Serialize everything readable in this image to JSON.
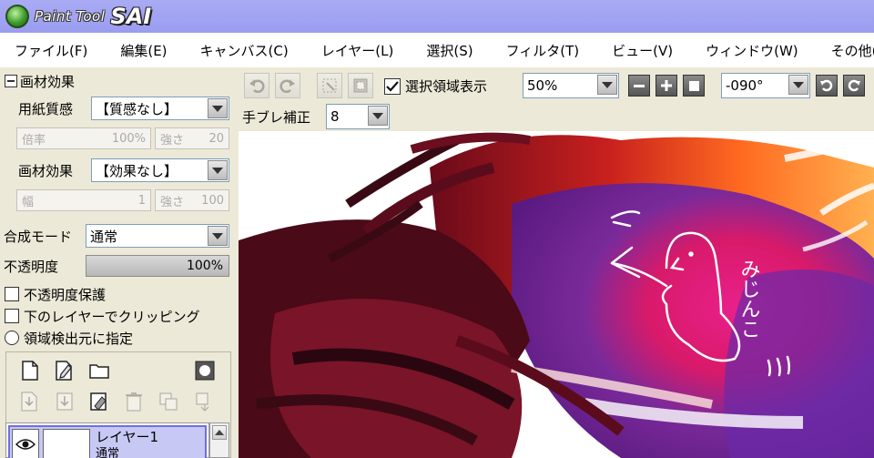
{
  "app": {
    "logo_small": "Paint Tool",
    "logo_big": "SAI"
  },
  "menu": [
    "ファイル(F)",
    "編集(E)",
    "キャンバス(C)",
    "レイヤー(L)",
    "選択(S)",
    "フィルタ(T)",
    "ビュー(V)",
    "ウィンドウ(W)",
    "その他(O)"
  ],
  "panel": {
    "section_title": "画材効果",
    "paper_label": "用紙質感",
    "paper_value": "【質感なし】",
    "paper_scale_label": "倍率",
    "paper_scale_value": "100%",
    "paper_strength_label": "強さ",
    "paper_strength_value": "20",
    "effect_label": "画材効果",
    "effect_value": "【効果なし】",
    "effect_width_label": "幅",
    "effect_width_value": "1",
    "effect_strength_label": "強さ",
    "effect_strength_value": "100",
    "blend_label": "合成モード",
    "blend_value": "通常",
    "opacity_label": "不透明度",
    "opacity_value": "100%",
    "opacity_fraction": 1.0,
    "protect_opacity_label": "不透明度保護",
    "clipping_label": "下のレイヤーでクリッピング",
    "selection_source_label": "領域検出元に指定"
  },
  "layers": [
    {
      "name": "レイヤー1",
      "mode": "通常"
    }
  ],
  "toolbar": {
    "show_selection_label": "選択領域表示",
    "show_selection_checked": true,
    "zoom_value": "50%",
    "rotation_value": "-090°",
    "stabilizer_label": "手ブレ補正",
    "stabilizer_value": "8"
  },
  "canvas": {
    "handwritten_text": "みじんこ"
  }
}
